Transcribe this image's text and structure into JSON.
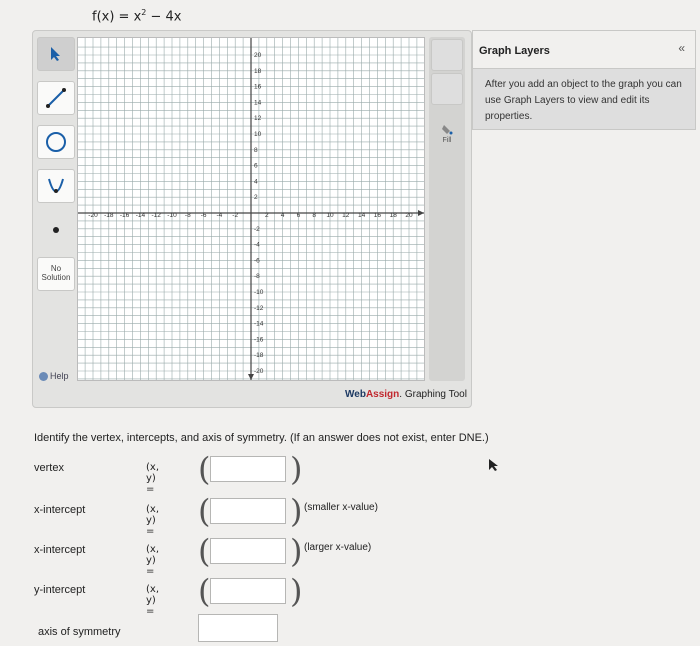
{
  "function_title": {
    "lhs": "f(x) = x",
    "exponent": "2",
    "rhs": " − 4x"
  },
  "tools": {
    "nosolution_label": "No Solution",
    "help_label": "Help",
    "fill_label": "Fill"
  },
  "graph": {
    "x_ticks": [
      "-20",
      "-18",
      "-16",
      "-14",
      "-12",
      "-10",
      "-8",
      "-6",
      "-4",
      "-2",
      "2",
      "4",
      "6",
      "8",
      "10",
      "12",
      "14",
      "16",
      "18",
      "20"
    ],
    "y_ticks": [
      "20",
      "18",
      "16",
      "14",
      "12",
      "10",
      "8",
      "6",
      "4",
      "2",
      "-2",
      "-4",
      "-6",
      "-8",
      "-10",
      "-12",
      "-14",
      "-16",
      "-18",
      "-20"
    ]
  },
  "branding": {
    "web": "Web",
    "assign": "Assign",
    "suffix": ". Graphing Tool"
  },
  "layers": {
    "title": "Graph Layers",
    "collapse": "«",
    "body": "After you add an object to the graph you can use Graph Layers to view and edit its properties."
  },
  "question": "Identify the vertex, intercepts, and axis of symmetry. (If an answer does not exist, enter DNE.)",
  "rows": [
    {
      "label": "vertex",
      "xy": "(x, y)  =",
      "note": ""
    },
    {
      "label": "x-intercept",
      "xy": "(x, y)  =",
      "note": "(smaller x-value)"
    },
    {
      "label": "x-intercept",
      "xy": "(x, y)  =",
      "note": "(larger x-value)"
    },
    {
      "label": "y-intercept",
      "xy": "(x, y)  =",
      "note": ""
    }
  ],
  "axis_of_symmetry": {
    "label": "axis of symmetry"
  }
}
